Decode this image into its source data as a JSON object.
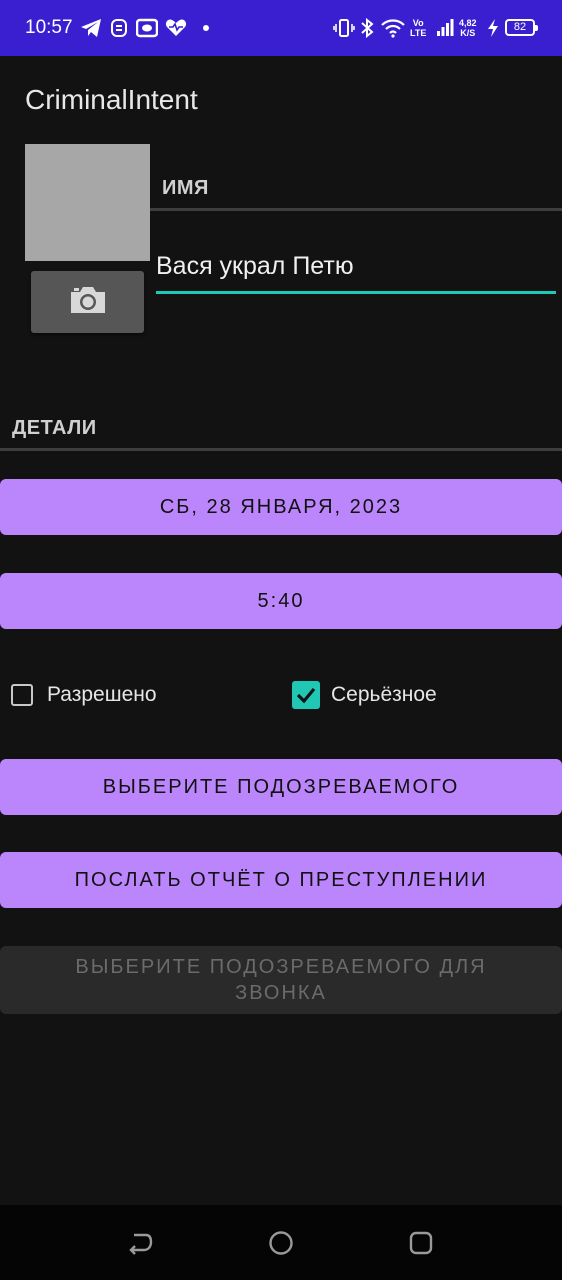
{
  "status_bar": {
    "time": "10:57",
    "volte_line1": "Vo",
    "volte_line2": "LTE",
    "speed_value": "4,82",
    "speed_unit": "K/S",
    "battery": "82"
  },
  "app_bar": {
    "title": "CriminalIntent"
  },
  "crime": {
    "name_label": "ИМЯ",
    "title_value": "Вася украл Петю",
    "details_label": "ДЕТАЛИ",
    "date_button": "СБ, 28 ЯНВАРЯ, 2023",
    "time_button": "5:40",
    "solved_label": "Разрешено",
    "solved_checked": false,
    "serious_label": "Серьёзное",
    "serious_checked": true,
    "suspect_button": "ВЫБЕРИТЕ ПОДОЗРЕВАЕМОГО",
    "report_button": "ПОСЛАТЬ ОТЧЁТ О ПРЕСТУПЛЕНИИ",
    "call_button": "ВЫБЕРИТЕ ПОДОЗРЕВАЕМОГО ДЛЯ ЗВОНКА"
  },
  "colors": {
    "status_bar": "#3a1fd0",
    "button_primary": "#bb86fc",
    "accent": "#21c7b5",
    "background": "#121212"
  }
}
